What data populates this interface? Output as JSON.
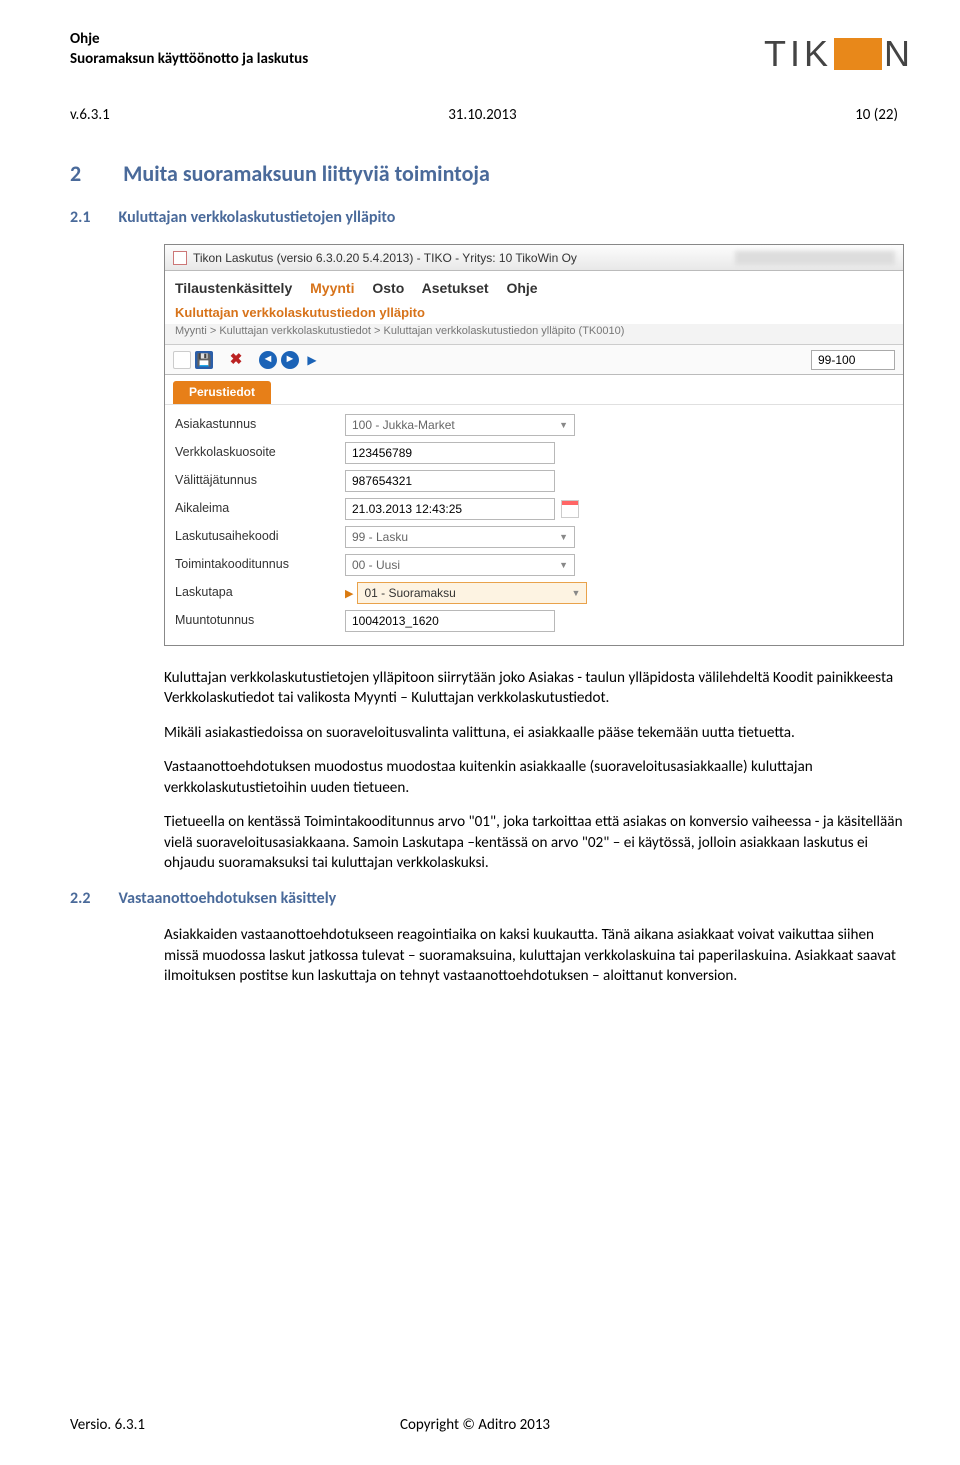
{
  "header": {
    "title": "Ohje",
    "subtitle": "Suoramaksun käyttöönotto ja laskutus",
    "logo_text": "TIK"
  },
  "meta": {
    "version": "v.6.3.1",
    "date": "31.10.2013",
    "page": "10 (22)"
  },
  "h1": {
    "num": "2",
    "text": "Muita suoramaksuun liittyviä toimintoja"
  },
  "h2a": {
    "num": "2.1",
    "text": "Kuluttajan verkkolaskutustietojen ylläpito"
  },
  "screenshot": {
    "window_title": "Tikon Laskutus (versio 6.3.0.20 5.4.2013) - TIKO - Yritys: 10 TikoWin Oy",
    "menu": [
      "Tilaustenkäsittely",
      "Myynti",
      "Osto",
      "Asetukset",
      "Ohje"
    ],
    "menu_selected": 1,
    "view_title": "Kuluttajan verkkolaskutustiedon ylläpito",
    "breadcrumb": "Myynti > Kuluttajan verkkolaskutustiedot > Kuluttajan verkkolaskutustiedon ylläpito  (TK0010)",
    "pager": "99-100",
    "tab": "Perustiedot",
    "fields": {
      "asiakastunnus_label": "Asiakastunnus",
      "asiakastunnus_value": "100 - Jukka-Market",
      "verkkolaskuosoite_label": "Verkkolaskuosoite",
      "verkkolaskuosoite_value": "123456789",
      "valittajatunnus_label": "Välittäjätunnus",
      "valittajatunnus_value": "987654321",
      "aikaleima_label": "Aikaleima",
      "aikaleima_value": "21.03.2013 12:43:25",
      "laskutusaihe_label": "Laskutusaihekoodi",
      "laskutusaihe_value": "99 - Lasku",
      "toimintakoodi_label": "Toimintakooditunnus",
      "toimintakoodi_value": "00 - Uusi",
      "laskutapa_label": "Laskutapa",
      "laskutapa_value": "01 - Suoramaksu",
      "muuntotunnus_label": "Muuntotunnus",
      "muuntotunnus_value": "10042013_1620"
    }
  },
  "para": {
    "p1": "Kuluttajan verkkolaskutustietojen ylläpitoon siirrytään joko Asiakas - taulun ylläpidosta välilehdeltä Koodit painikkeesta Verkkolaskutiedot tai valikosta Myynti – Kuluttajan verkkolaskutustiedot.",
    "p2": "Mikäli asiakastiedoissa on suoraveloitusvalinta valittuna, ei asiakkaalle pääse tekemään uutta tietuetta.",
    "p3": "Vastaanottoehdotuksen muodostus muodostaa kuitenkin asiakkaalle (suoraveloitusasiakkaalle) kuluttajan verkkolaskutustietoihin uuden tietueen.",
    "p4": "Tietueella on kentässä Toimintakooditunnus arvo \"01\", joka tarkoittaa että asiakas on konversio vaiheessa - ja käsitellään vielä suoraveloitusasiakkaana. Samoin Laskutapa –kentässä on arvo \"02\" – ei käytössä, jolloin asiakkaan laskutus ei ohjaudu suoramaksuksi tai kuluttajan verkkolaskuksi."
  },
  "h2b": {
    "num": "2.2",
    "text": "Vastaanottoehdotuksen käsittely"
  },
  "para2": {
    "p1": "Asiakkaiden vastaanottoehdotukseen reagointiaika on kaksi kuukautta. Tänä aikana asiakkaat voivat vaikuttaa siihen missä muodossa laskut jatkossa tulevat – suoramaksuina, kuluttajan verkkolaskuina tai paperilaskuina. Asiakkaat saavat ilmoituksen postitse kun laskuttaja on tehnyt vastaanottoehdotuksen – aloittanut konversion."
  },
  "footer": {
    "left": "Versio. 6.3.1",
    "center": "Copyright © Aditro 2013"
  }
}
